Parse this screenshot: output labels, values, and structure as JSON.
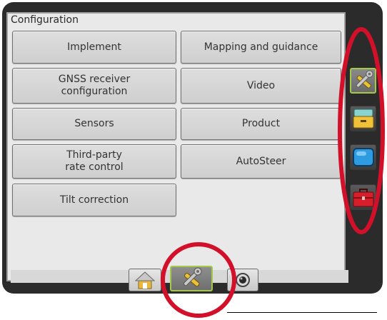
{
  "panel": {
    "title": "Configuration"
  },
  "buttons": [
    {
      "label": "Implement"
    },
    {
      "label": "Mapping and guidance"
    },
    {
      "label": "GNSS receiver\nconfiguration"
    },
    {
      "label": "Video"
    },
    {
      "label": "Sensors"
    },
    {
      "label": "Product"
    },
    {
      "label": "Third-party\nrate control"
    },
    {
      "label": "AutoSteer"
    },
    {
      "label": "Tilt correction"
    }
  ],
  "bottom_tabs": [
    {
      "icon": "home-icon",
      "selected": false
    },
    {
      "icon": "tools-icon",
      "selected": true
    },
    {
      "icon": "camera-icon",
      "selected": false
    }
  ],
  "side_tabs": [
    {
      "icon": "tools-icon",
      "selected": true
    },
    {
      "icon": "console-icon",
      "selected": false
    },
    {
      "icon": "screen-icon",
      "selected": false
    },
    {
      "icon": "toolbox-icon",
      "selected": false
    }
  ],
  "colors": {
    "annotation_red": "#d3102a",
    "selected_border": "#a6c84a",
    "device_frame": "#2b2b2b"
  }
}
